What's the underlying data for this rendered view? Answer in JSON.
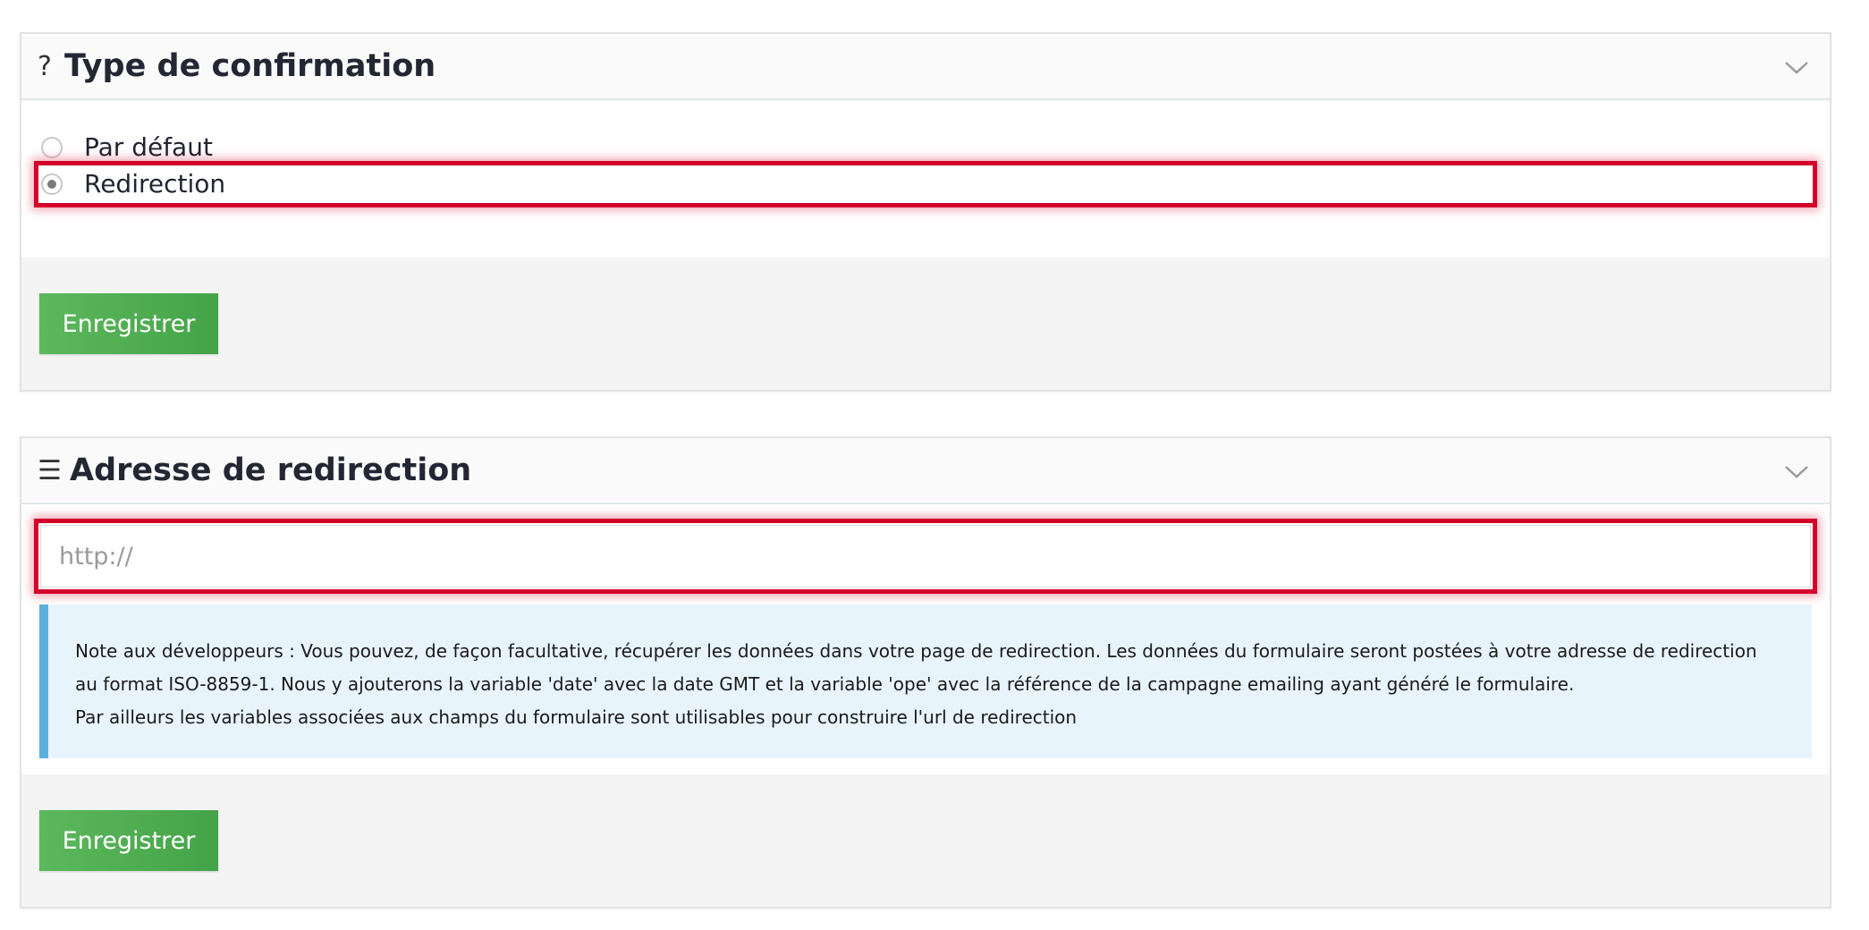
{
  "confirmation_panel": {
    "title": "Type de confirmation",
    "icon": "question-mark-icon",
    "options": [
      {
        "label": "Par défaut",
        "selected": false
      },
      {
        "label": "Redirection",
        "selected": true
      }
    ],
    "save_label": "Enregistrer"
  },
  "redirect_panel": {
    "title": "Adresse de redirection",
    "icon": "list-icon",
    "url_input": {
      "value": "",
      "placeholder": "http://"
    },
    "note_lines": [
      "Note aux développeurs : Vous pouvez, de façon facultative, récupérer les données dans votre page de redirection. Les données du formulaire seront postées à votre adresse de redirection",
      "au format ISO-8859-1. Nous y ajouterons la variable 'date' avec la date GMT et la variable 'ope' avec la référence de la campagne emailing ayant généré le formulaire.",
      "Par ailleurs les variables associées aux champs du formulaire sont utilisables pour construire l'url de redirection"
    ],
    "save_label": "Enregistrer"
  },
  "colors": {
    "highlight": "#d3002a",
    "button": "#5cb85c",
    "note_background": "#e8f4fb",
    "note_border": "#5bb0d9"
  }
}
